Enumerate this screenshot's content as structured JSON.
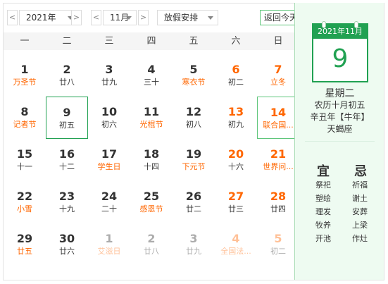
{
  "toolbar": {
    "prev_year": "<",
    "year": "2021年",
    "next_year": ">",
    "prev_month": "<",
    "month": "11月",
    "next_month": ">",
    "holiday": "放假安排",
    "today": "返回今天"
  },
  "weekdays": [
    "一",
    "二",
    "三",
    "四",
    "五",
    "六",
    "日"
  ],
  "weeks": [
    [
      {
        "d": "1",
        "l": "万圣节",
        "fest": true
      },
      {
        "d": "2",
        "l": "廿八"
      },
      {
        "d": "3",
        "l": "廿九"
      },
      {
        "d": "4",
        "l": "三十"
      },
      {
        "d": "5",
        "l": "寒衣节",
        "fest": true
      },
      {
        "d": "6",
        "l": "初二",
        "we": true
      },
      {
        "d": "7",
        "l": "立冬",
        "we": true,
        "fest": true
      }
    ],
    [
      {
        "d": "8",
        "l": "记者节",
        "fest": true
      },
      {
        "d": "9",
        "l": "初五",
        "sel": true
      },
      {
        "d": "10",
        "l": "初六"
      },
      {
        "d": "11",
        "l": "光棍节",
        "fest": true
      },
      {
        "d": "12",
        "l": "初八"
      },
      {
        "d": "13",
        "l": "初九",
        "we": true
      },
      {
        "d": "14",
        "l": "联合国...",
        "we": true,
        "fest": true,
        "holiday": true
      }
    ],
    [
      {
        "d": "15",
        "l": "十一"
      },
      {
        "d": "16",
        "l": "十二"
      },
      {
        "d": "17",
        "l": "学生日",
        "fest": true
      },
      {
        "d": "18",
        "l": "十四"
      },
      {
        "d": "19",
        "l": "下元节",
        "fest": true
      },
      {
        "d": "20",
        "l": "十六",
        "we": true
      },
      {
        "d": "21",
        "l": "世界问...",
        "we": true,
        "fest": true
      }
    ],
    [
      {
        "d": "22",
        "l": "小雪",
        "fest": true
      },
      {
        "d": "23",
        "l": "十九"
      },
      {
        "d": "24",
        "l": "二十"
      },
      {
        "d": "25",
        "l": "感恩节",
        "fest": true
      },
      {
        "d": "26",
        "l": "廿二"
      },
      {
        "d": "27",
        "l": "廿三",
        "we": true
      },
      {
        "d": "28",
        "l": "廿四",
        "we": true
      }
    ],
    [
      {
        "d": "29",
        "l": "廿五",
        "fest": true
      },
      {
        "d": "30",
        "l": "廿六"
      },
      {
        "d": "1",
        "l": "艾滋日",
        "fest": true,
        "other": true
      },
      {
        "d": "2",
        "l": "廿八",
        "other": true
      },
      {
        "d": "3",
        "l": "廿九",
        "other": true
      },
      {
        "d": "4",
        "l": "全国法...",
        "we": true,
        "fest": true,
        "other": true
      },
      {
        "d": "5",
        "l": "初二",
        "we": true,
        "other": true
      }
    ]
  ],
  "panel": {
    "page_header": "2021年11月",
    "page_day": "9",
    "weekday": "星期二",
    "lunar": "农历十月初五",
    "ganzhi": "辛丑年【牛年】",
    "zodiac": "天蝎座",
    "yi_title": "宜",
    "ji_title": "忌",
    "yi": [
      "祭祀",
      "塑绘",
      "理发",
      "牧养",
      "开池"
    ],
    "ji": [
      "祈福",
      "谢土",
      "安葬",
      "上梁",
      "作灶"
    ]
  },
  "colors": {
    "accent_green": "#21a152",
    "festival_orange": "#ff6600",
    "panel_bg": "#eefbf1"
  }
}
